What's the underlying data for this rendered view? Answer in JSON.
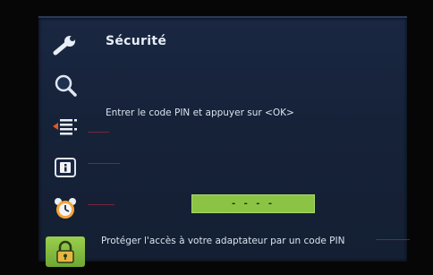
{
  "screen": {
    "title": "Sécurité",
    "instruction": "Entrer le code PIN et appuyer sur <OK>",
    "pin_display": "- - - -",
    "help_text": "Protéger l'accès à votre adaptateur par un code PIN"
  },
  "sidebar": {
    "items": [
      {
        "icon": "wrench-icon",
        "active": false
      },
      {
        "icon": "magnifier-icon",
        "active": false
      },
      {
        "icon": "channel-list-icon",
        "active": false
      },
      {
        "icon": "info-icon",
        "active": false
      },
      {
        "icon": "alarm-clock-icon",
        "active": false
      },
      {
        "icon": "padlock-icon",
        "active": true
      }
    ]
  },
  "colors": {
    "background": "#162238",
    "accent_green": "#8bc444",
    "text": "#dbe3ee"
  }
}
